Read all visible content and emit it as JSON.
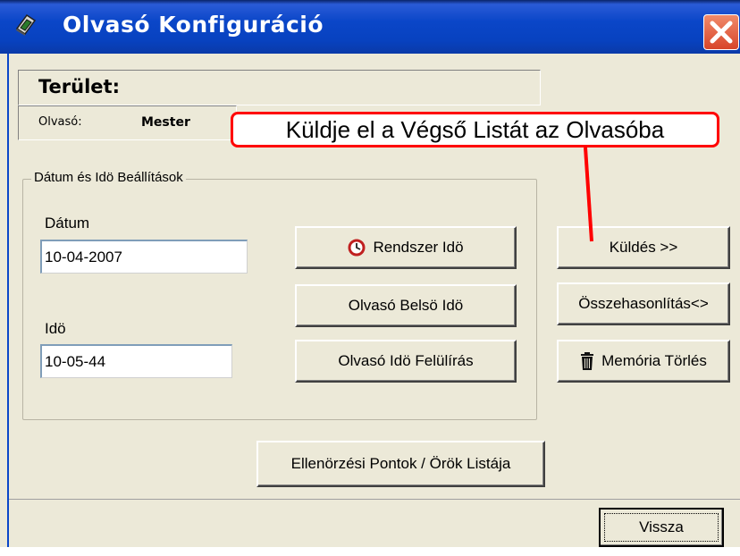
{
  "window": {
    "title": "Olvasó Konfiguráció"
  },
  "area": {
    "label": "Terület:"
  },
  "reader": {
    "label": "Olvasó:",
    "value": "Mester"
  },
  "callout": {
    "text": "Küldje el a Végső Listát az Olvasóba",
    "color": "#ff0000"
  },
  "datetime": {
    "group_title": "Dátum és Idö Beállítások",
    "date_label": "Dátum",
    "date_value": "10-04-2007",
    "time_label": "Idö",
    "time_value": "10-05-44"
  },
  "buttons": {
    "system_time": "Rendszer Idö",
    "reader_internal_time": "Olvasó Belsö Idö",
    "reader_time_overwrite": "Olvasó Idö Felülírás",
    "send": "Küldés >>",
    "compare": "Összehasonlítás<>",
    "memory_clear": "Memória Törlés",
    "checkpoints_list": "Ellenörzési Pontok / Örök Listája",
    "back": "Vissza"
  },
  "icons": {
    "app": "reader-device-icon",
    "close": "close-icon",
    "clock": "clock-icon",
    "trash": "trash-icon"
  }
}
